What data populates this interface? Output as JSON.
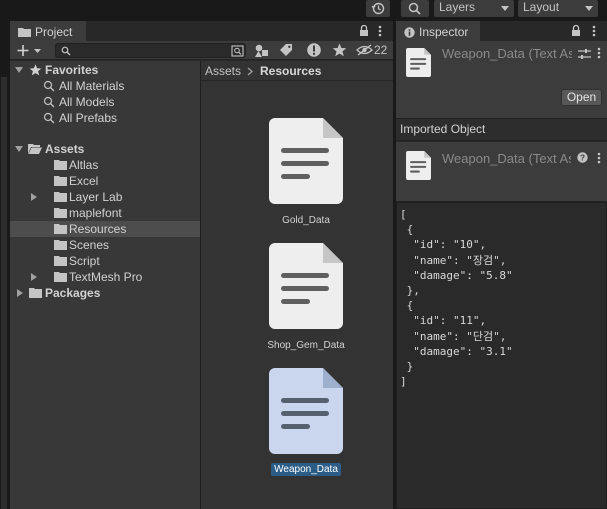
{
  "toolbar": {
    "layers_label": "Layers",
    "layout_label": "Layout"
  },
  "project": {
    "tab_label": "Project",
    "search_placeholder": "",
    "hidden_count": "22",
    "favorites": {
      "label": "Favorites",
      "items": [
        "All Materials",
        "All Models",
        "All Prefabs"
      ]
    },
    "assets": {
      "label": "Assets",
      "children": [
        "Altlas",
        "Excel",
        "Layer Lab",
        "maplefont",
        "Resources",
        "Scenes",
        "Script",
        "TextMesh Pro"
      ],
      "selected": "Resources"
    },
    "packages_label": "Packages",
    "breadcrumb": {
      "root": "Assets",
      "current": "Resources"
    },
    "files": [
      {
        "name": "Gold_Data",
        "selected": false
      },
      {
        "name": "Shop_Gem_Data",
        "selected": false
      },
      {
        "name": "Weapon_Data",
        "selected": true
      }
    ]
  },
  "inspector": {
    "tab_label": "Inspector",
    "header_title": "Weapon_Data (Text Asset)",
    "open_button": "Open",
    "imported_object_label": "Imported Object",
    "sub_title": "Weapon_Data (Text Asset)",
    "json_text": "[\n {\n  \"id\": \"10\",\n  \"name\": \"장검\",\n  \"damage\": \"5.8\"\n },\n {\n  \"id\": \"11\",\n  \"name\": \"단검\",\n  \"damage\": \"3.1\"\n }\n]"
  },
  "colors": {
    "selection": "#2c5d87",
    "file_icon": "#eeeeee",
    "file_icon_selected": "#c9d6ee"
  }
}
